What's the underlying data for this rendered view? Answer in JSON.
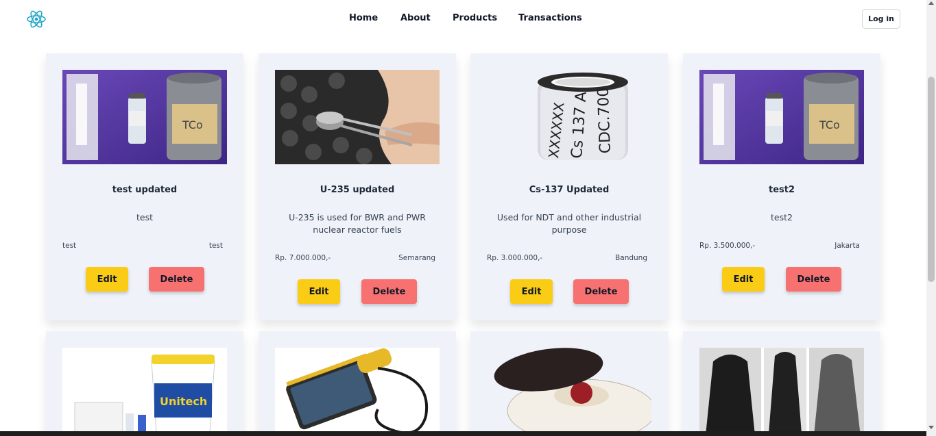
{
  "nav": {
    "links": [
      "Home",
      "About",
      "Products",
      "Transactions"
    ],
    "login_label": "Log in"
  },
  "products": [
    {
      "title": "test updated",
      "description": "test",
      "price": "test",
      "location": "test",
      "image": "radioactive-kit-photo"
    },
    {
      "title": "U-235 updated",
      "description": "U-235 is used for BWR and PWR nuclear reactor fuels",
      "price": "Rp. 7.000.000,-",
      "location": "Semarang",
      "image": "uranium-pellet-tweezers-photo"
    },
    {
      "title": "Cs-137 Updated",
      "description": "Used for NDT and other industrial purpose",
      "price": "Rp. 3.000.000,-",
      "location": "Bandung",
      "image": "cs137-source-capsule-photo",
      "capsule_text": [
        "XXXXXX",
        "Cs 137  A",
        "CDC.700"
      ]
    },
    {
      "title": "test2",
      "description": "test2",
      "price": "Rp. 3.500.000,-",
      "location": "Jakarta",
      "image": "radioactive-kit-photo"
    }
  ],
  "products_row2": [
    {
      "image": "decontamination-kit-bucket-photo",
      "bucket_text": "Unitech"
    },
    {
      "image": "handheld-detector-tablet-photo"
    },
    {
      "image": "lead-container-photo"
    },
    {
      "image": "protective-suits-photo"
    }
  ],
  "buttons": {
    "edit": "Edit",
    "delete": "Delete"
  },
  "icons": {
    "logo": "react-atom-icon"
  },
  "colors": {
    "edit": "#facc15",
    "delete": "#f87171",
    "card_bg": "#eff3f9",
    "logo": "#22a6c8"
  }
}
